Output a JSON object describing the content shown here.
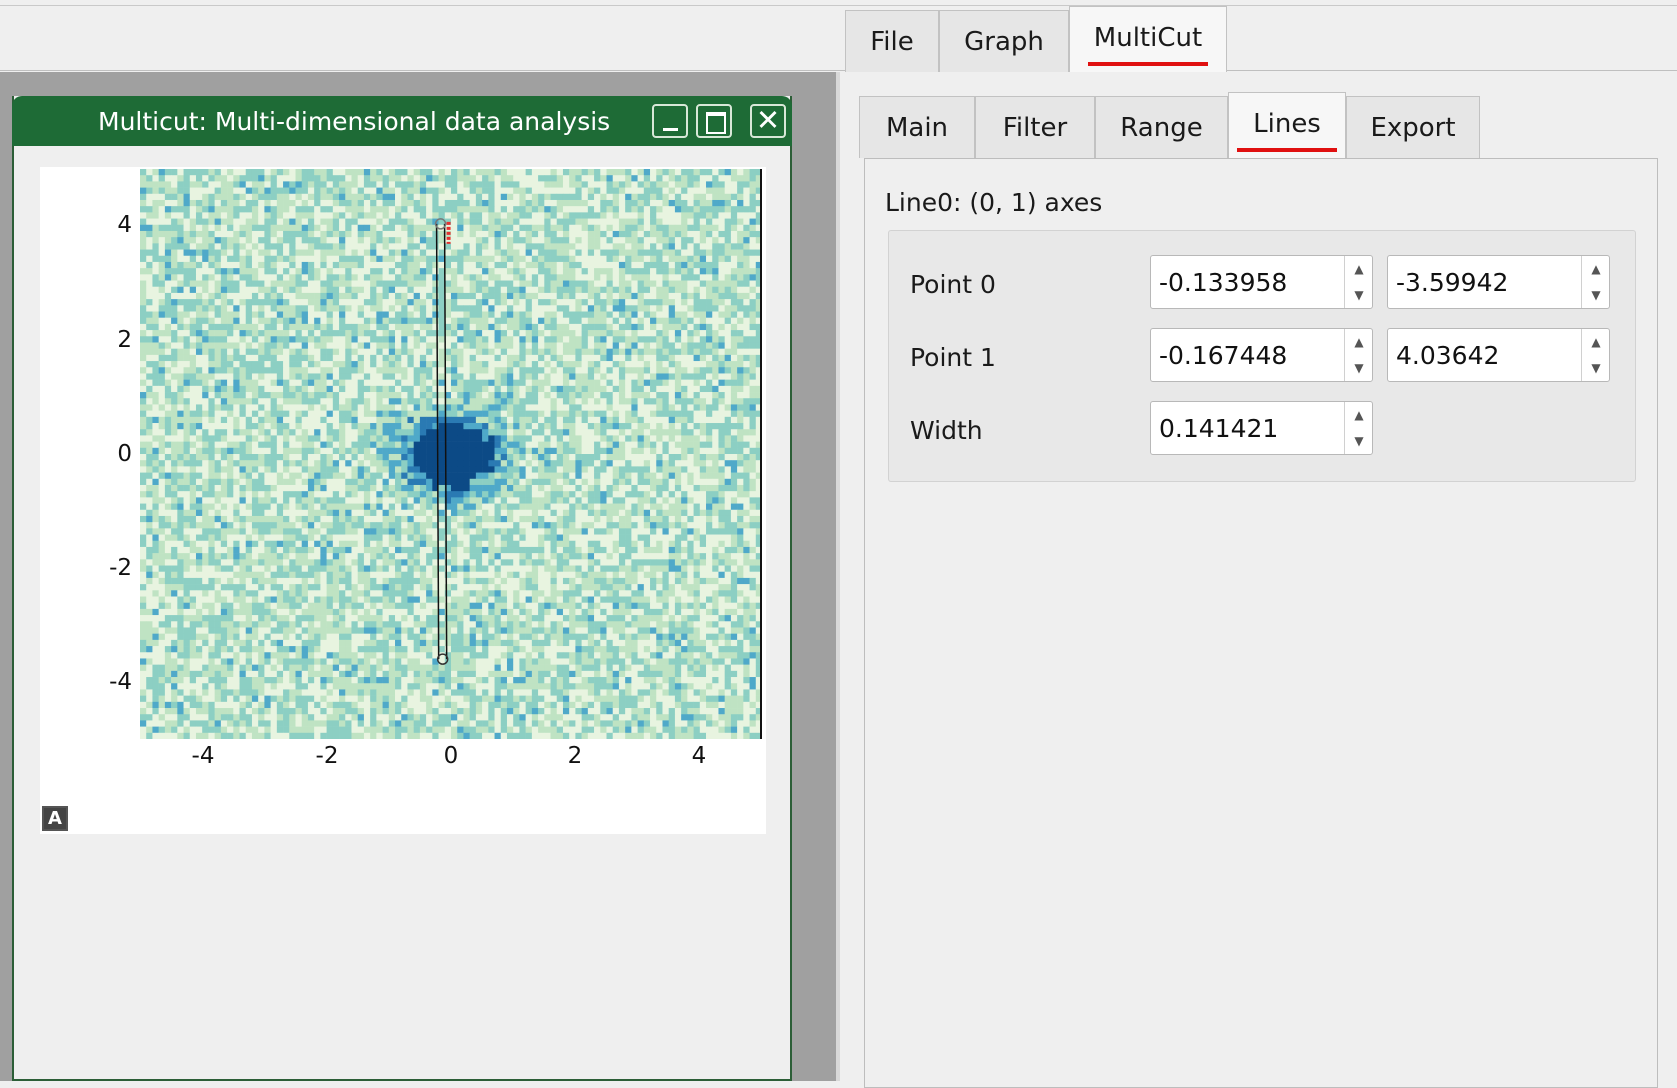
{
  "main_tabs": [
    {
      "label": "File"
    },
    {
      "label": "Graph"
    },
    {
      "label": "MultiCut",
      "active": true
    }
  ],
  "subwindow": {
    "title": "Multicut: Multi-dimensional data analysis",
    "minimize_icon": "minimize-icon",
    "maximize_icon": "maximize-icon",
    "close_icon": "close-icon"
  },
  "plot": {
    "yticks": [
      "4",
      "2",
      "0",
      "-2",
      "-4"
    ],
    "xticks": [
      "-4",
      "-2",
      "0",
      "2",
      "4"
    ],
    "autoscale_label": "A",
    "line_overlay": {
      "p0": [
        -0.133958,
        -3.59942
      ],
      "p1": [
        -0.167448,
        4.03642
      ]
    },
    "colormap": [
      "#e8f4e0",
      "#bfe3c3",
      "#8ccfc3",
      "#4fa9c9",
      "#2a7ab3",
      "#0c4a86"
    ]
  },
  "sub_tabs": [
    {
      "label": "Main"
    },
    {
      "label": "Filter"
    },
    {
      "label": "Range"
    },
    {
      "label": "Lines",
      "active": true
    },
    {
      "label": "Export"
    }
  ],
  "lines": {
    "title": "Line0: (0, 1) axes",
    "rows": [
      {
        "label": "Point 0",
        "x": "-0.133958",
        "y": "-3.59942"
      },
      {
        "label": "Point 1",
        "x": "-0.167448",
        "y": "4.03642"
      },
      {
        "label": "Width",
        "value": "0.141421"
      }
    ]
  }
}
